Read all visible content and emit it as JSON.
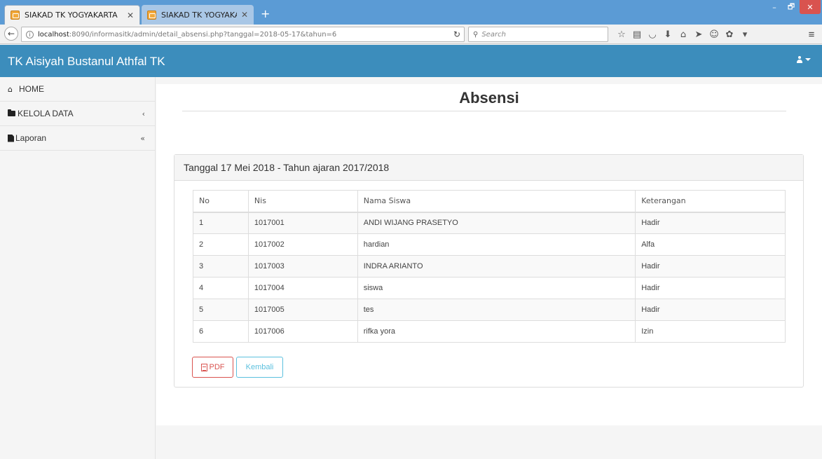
{
  "browser": {
    "tabs": [
      {
        "label": "SIAKAD TK YOGYAKARTA",
        "close": "✕"
      },
      {
        "label": "SIAKAD TK YOGYAKARTA",
        "close": "✕"
      }
    ],
    "new_tab": "+",
    "window_controls": {
      "minimize": "–",
      "maximize": "🗗",
      "close": "✕"
    },
    "url_host": "localhost",
    "url_rest": ":8090/informasitk/admin/detail_absensi.php?tanggal=2018-05-17&tahun=6",
    "search_placeholder": "Search"
  },
  "app": {
    "brand": "TK Aisiyah Bustanul Athfal TK"
  },
  "sidebar": {
    "items": [
      {
        "label": "HOME",
        "arrow": ""
      },
      {
        "label": "KELOLA DATA",
        "arrow": "‹"
      },
      {
        "label": "Laporan",
        "arrow": "«"
      }
    ]
  },
  "main": {
    "title": "Absensi",
    "panel_heading": "Tanggal 17 Mei 2018 - Tahun ajaran 2017/2018",
    "columns": [
      "No",
      "Nis",
      "Nama Siswa",
      "Keterangan"
    ],
    "rows": [
      {
        "no": "1",
        "nis": "1017001",
        "nama": "ANDI WIJANG PRASETYO",
        "ket": "Hadir"
      },
      {
        "no": "2",
        "nis": "1017002",
        "nama": "hardian",
        "ket": "Alfa"
      },
      {
        "no": "3",
        "nis": "1017003",
        "nama": "INDRA ARIANTO",
        "ket": "Hadir"
      },
      {
        "no": "4",
        "nis": "1017004",
        "nama": "siswa",
        "ket": "Hadir"
      },
      {
        "no": "5",
        "nis": "1017005",
        "nama": "tes",
        "ket": "Hadir"
      },
      {
        "no": "6",
        "nis": "1017006",
        "nama": "rifka yora",
        "ket": "Izin"
      }
    ],
    "pdf_button": "PDF",
    "back_button": "Kembali"
  },
  "colors": {
    "header": "#3c8dbc",
    "browser_chrome": "#5b9bd5",
    "danger": "#d9534f",
    "info": "#5bc0de"
  },
  "icons": {
    "home": "home-icon",
    "kelola": "folder-icon",
    "laporan": "file-icon",
    "pdf": "pdf-icon",
    "user": "user-icon"
  }
}
